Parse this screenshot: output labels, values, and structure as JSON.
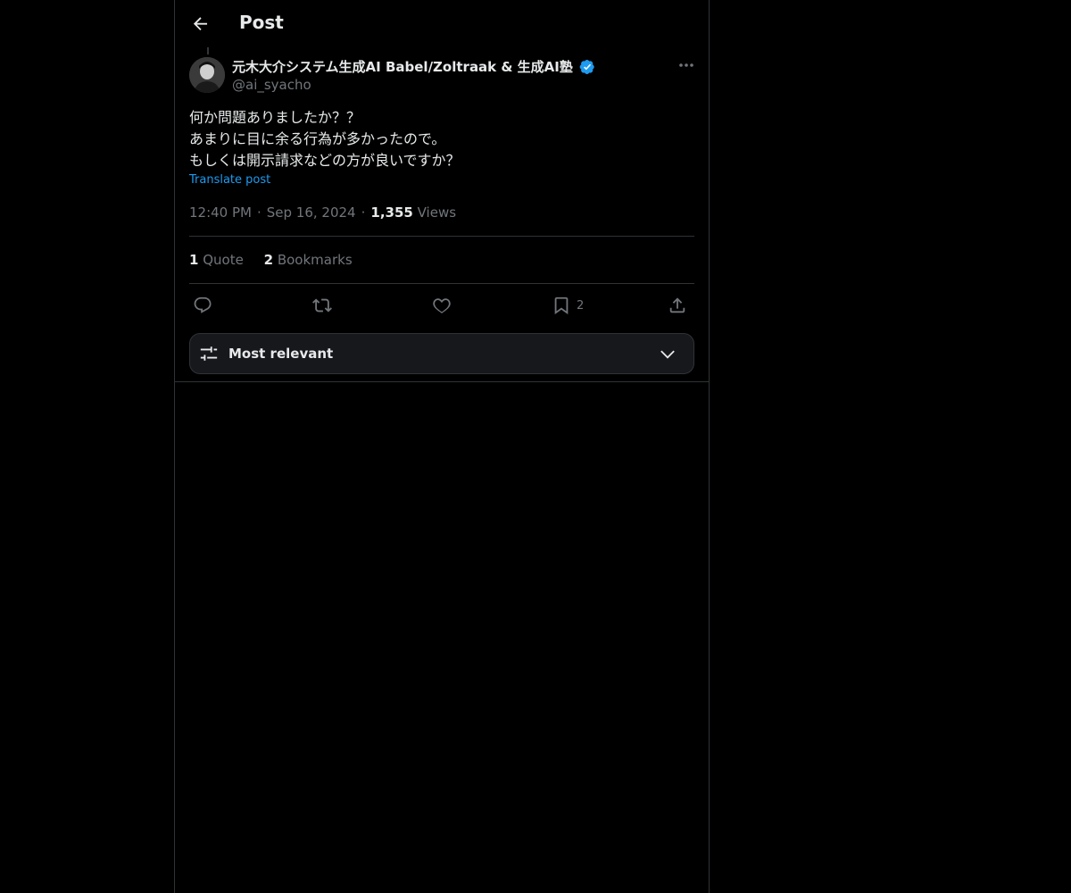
{
  "header": {
    "title": "Post",
    "back_icon": "arrow-left-icon"
  },
  "post": {
    "author": {
      "display_name": "元木大介システム生成AI Babel/Zoltraak & 生成AI塾",
      "handle": "@ai_syacho",
      "verified": true,
      "verified_color": "#1d9bf0"
    },
    "body_lines": [
      "何か問題ありましたか？？",
      "あまりに目に余る行為が多かったので。",
      "もしくは開示請求などの方が良いですか？"
    ],
    "translate_label": "Translate post",
    "time": "12:40 PM",
    "date": "Sep 16, 2024",
    "views_count": "1,355",
    "views_label": "Views",
    "stats": {
      "quote_count": "1",
      "quote_label": "Quote",
      "bookmarks_count": "2",
      "bookmarks_label": "Bookmarks"
    },
    "actions": {
      "reply_icon": "reply-icon",
      "repost_icon": "repost-icon",
      "like_icon": "heart-icon",
      "bookmark_icon": "bookmark-icon",
      "bookmark_count": "2",
      "share_icon": "share-icon"
    }
  },
  "sort": {
    "label": "Most relevant",
    "icon": "sliders-icon",
    "chevron": "chevron-down-icon"
  },
  "colors": {
    "background": "#000000",
    "text": "#e7e9ea",
    "muted": "#71767b",
    "accent": "#1d9bf0",
    "border": "#2f3336"
  }
}
